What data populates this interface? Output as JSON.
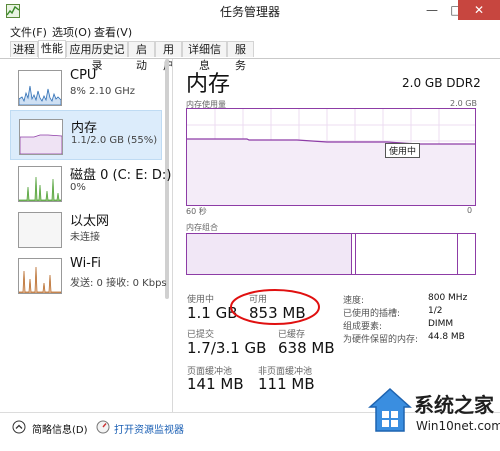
{
  "window": {
    "title": "任务管理器",
    "min": "—",
    "max": "□",
    "close": "✕"
  },
  "menu": [
    "文件(F)",
    "选项(O)",
    "查看(V)"
  ],
  "tabs": [
    "进程",
    "性能",
    "应用历史记录",
    "启动",
    "用户",
    "详细信息",
    "服务"
  ],
  "sidebar": [
    {
      "name": "CPU",
      "sub": "8% 2.10 GHz",
      "graph_color": "#2f6fb5"
    },
    {
      "name": "内存",
      "sub": "1.1/2.0 GB (55%)",
      "graph_color": "#8d3ca6"
    },
    {
      "name": "磁盘 0 (C: E: D:)",
      "sub": "0%",
      "graph_color": "#54a33b"
    },
    {
      "name": "以太网",
      "sub": "未连接",
      "graph_color": "#999999"
    },
    {
      "name": "Wi-Fi",
      "sub": "发送: 0 接收: 0 Kbps",
      "graph_color": "#b86b2b"
    }
  ],
  "main": {
    "title": "内存",
    "spec": "2.0 GB DDR2",
    "usage_label": "内存使用量",
    "usage_max": "2.0 GB",
    "usage_tooltip": "使用中",
    "time_label": "60 秒",
    "time_end": "0",
    "composition_label": "内存组合",
    "stats": {
      "in_use_label": "使用中",
      "in_use": "1.1 GB",
      "available_label": "可用",
      "available": "853 MB",
      "committed_label": "已提交",
      "committed": "1.7/3.1 GB",
      "cached_label": "已缓存",
      "cached": "638 MB",
      "paged_label": "页面缓冲池",
      "paged": "141 MB",
      "nonpaged_label": "非页面缓冲池",
      "nonpaged": "111 MB"
    },
    "details": [
      {
        "label": "速度:",
        "value": "800 MHz"
      },
      {
        "label": "已使用的插槽:",
        "value": "1/2"
      },
      {
        "label": "组成要素:",
        "value": "DIMM"
      },
      {
        "label": "为硬件保留的内存:",
        "value": "44.8 MB"
      }
    ]
  },
  "footer": {
    "summary": "简略信息(D)",
    "resource_monitor": "打开资源监视器"
  },
  "watermark": {
    "brand": "系统之家",
    "site": "Win10net.com"
  },
  "colors": {
    "accent": "#8d3ca6",
    "highlight": "#dcecfb",
    "annotation": "#e01010"
  }
}
